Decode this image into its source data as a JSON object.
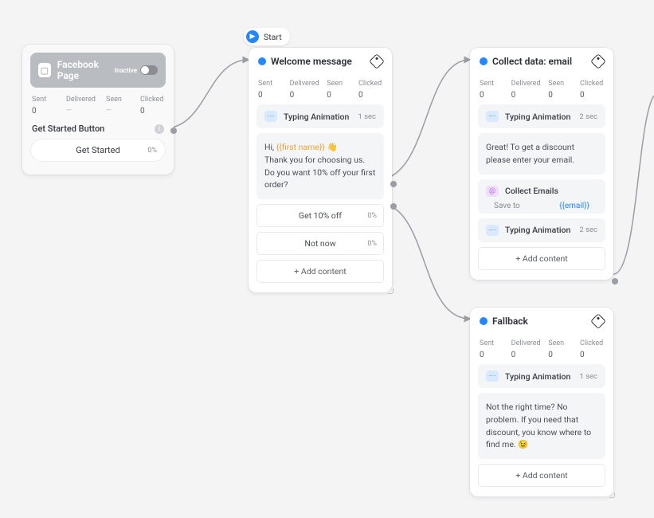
{
  "start_label": "Start",
  "facebook_card": {
    "title": "Facebook Page",
    "status": "Inactive",
    "stats": [
      {
        "label": "Sent",
        "value": "0"
      },
      {
        "label": "Delivered",
        "value": "—"
      },
      {
        "label": "Seen",
        "value": "—"
      },
      {
        "label": "Clicked",
        "value": "0"
      }
    ],
    "section_label": "Get Started Button",
    "button_label": "Get Started",
    "button_pct": "0%"
  },
  "welcome": {
    "title": "Welcome message",
    "stats": [
      {
        "label": "Sent",
        "value": "0"
      },
      {
        "label": "Delivered",
        "value": "0"
      },
      {
        "label": "Seen",
        "value": "0"
      },
      {
        "label": "Clicked",
        "value": "0"
      }
    ],
    "typing_label": "Typing Animation",
    "typing_time": "1 sec",
    "msg_hi": "Hi, ",
    "msg_name": "{{first name}}",
    "msg_wave": " 👋",
    "msg_body": "Thank you for choosing us. Do you want 10% off your first order?",
    "btn1": "Get 10% off",
    "btn1_pct": "0%",
    "btn2": "Not now",
    "btn2_pct": "0%",
    "add": "+ Add content"
  },
  "collect_email": {
    "title": "Collect data: email",
    "stats": [
      {
        "label": "Sent",
        "value": "0"
      },
      {
        "label": "Delivered",
        "value": "0"
      },
      {
        "label": "Seen",
        "value": "0"
      },
      {
        "label": "Clicked",
        "value": "0"
      }
    ],
    "typing_label": "Typing Animation",
    "typing_time": "2 sec",
    "msg_body": "Great! To get a discount please enter your email.",
    "collect_label": "Collect Emails",
    "save_to": "Save to",
    "save_var": "{{email}}",
    "typing2_label": "Typing Animation",
    "typing2_time": "2 sec",
    "add": "+ Add content"
  },
  "fallback": {
    "title": "Fallback",
    "stats": [
      {
        "label": "Sent",
        "value": "0"
      },
      {
        "label": "Delivered",
        "value": "0"
      },
      {
        "label": "Seen",
        "value": "0"
      },
      {
        "label": "Clicked",
        "value": "0"
      }
    ],
    "typing_label": "Typing Animation",
    "typing_time": "1 sec",
    "msg_body": "Not the right time? No problem. If you need that discount, you know where to find me. 😉",
    "add": "+ Add content"
  }
}
